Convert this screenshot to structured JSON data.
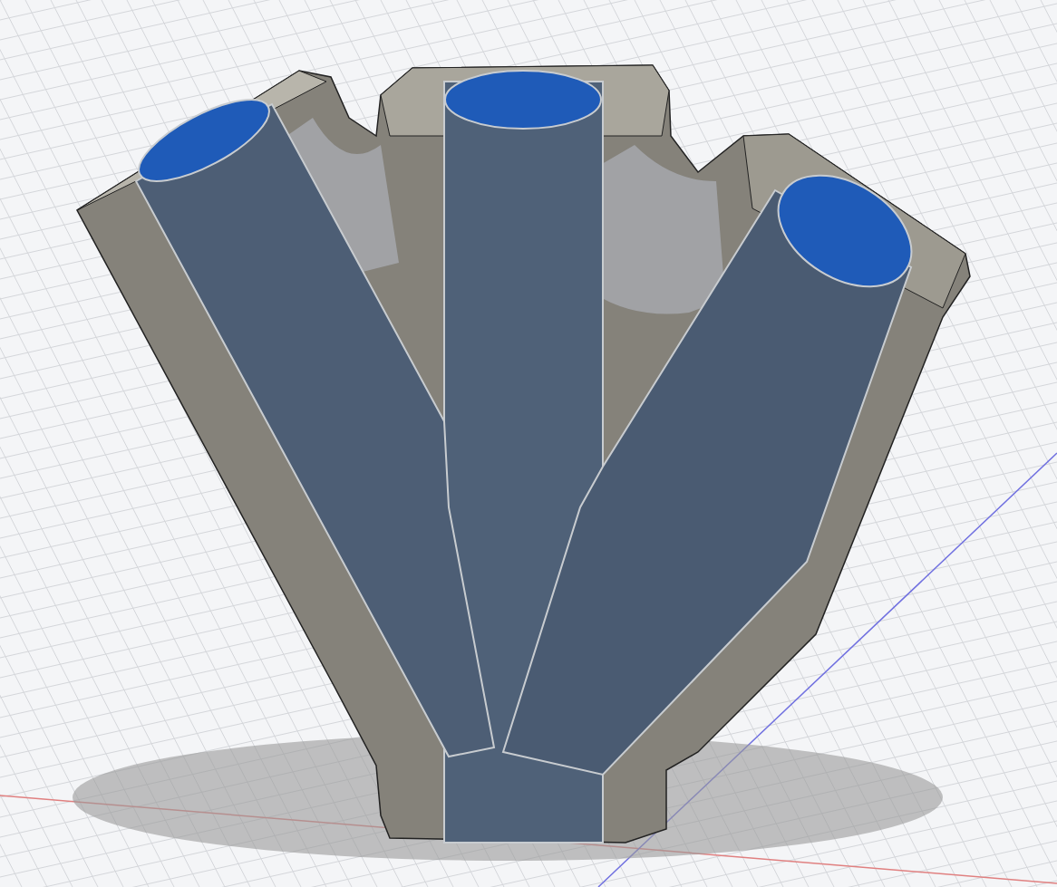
{
  "viewport": {
    "kind": "model"
  }
}
